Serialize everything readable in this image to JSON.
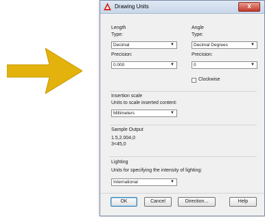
{
  "window": {
    "title": "Drawing Units",
    "close_glyph": "X"
  },
  "length": {
    "heading": "Length",
    "type_label": "Type:",
    "type_value": "Decimal",
    "precision_label": "Precision:",
    "precision_value": "0.000"
  },
  "angle": {
    "heading": "Angle",
    "type_label": "Type:",
    "type_value": "Decimal Degrees",
    "precision_label": "Precision:",
    "precision_value": "0",
    "clockwise_label": "Clockwise",
    "clockwise_checked": false
  },
  "insertion_scale": {
    "heading": "Insertion scale",
    "units_label": "Units to scale inserted content:",
    "units_value": "Millimeters"
  },
  "sample_output": {
    "heading": "Sample Output",
    "line1": "1.5,2.004,0",
    "line2": "3<45,0"
  },
  "lighting": {
    "heading": "Lighting",
    "units_label": "Units for specifying the intensity of lighting:",
    "units_value": "International"
  },
  "buttons": {
    "ok": "OK",
    "cancel": "Cancel",
    "direction": "Direction...",
    "help": "Help"
  },
  "colors": {
    "arrow": "#e3b20c",
    "close_button": "#c0392b",
    "app_icon": "#d42a1f"
  }
}
